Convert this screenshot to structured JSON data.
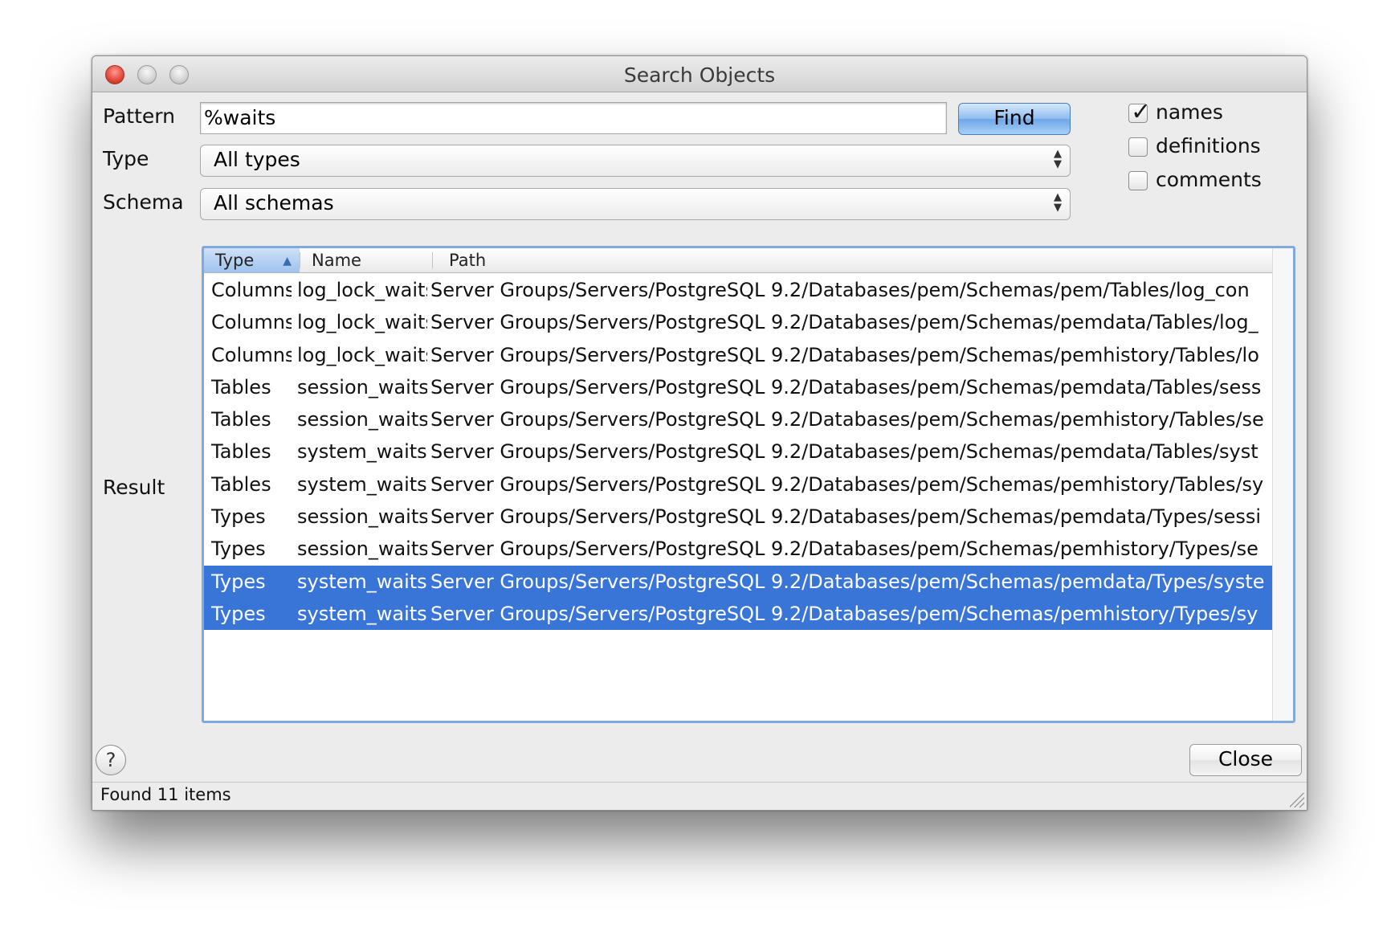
{
  "window": {
    "title": "Search Objects"
  },
  "labels": {
    "pattern": "Pattern",
    "type": "Type",
    "schema": "Schema",
    "result": "Result"
  },
  "pattern": {
    "value": "%waits"
  },
  "find_button": "Find",
  "type_select": {
    "value": "All types"
  },
  "schema_select": {
    "value": "All schemas"
  },
  "options": [
    {
      "label": "names",
      "checked": true
    },
    {
      "label": "definitions",
      "checked": false
    },
    {
      "label": "comments",
      "checked": false
    }
  ],
  "table": {
    "columns": [
      "Type",
      "Name",
      "Path"
    ],
    "sorted_column": "Type",
    "sort_direction": "ascending",
    "rows": [
      {
        "type": "Columns",
        "name": "log_lock_waits",
        "path": "Server Groups/Servers/PostgreSQL 9.2/Databases/pem/Schemas/pem/Tables/log_con",
        "selected": false
      },
      {
        "type": "Columns",
        "name": "log_lock_waits",
        "path": "Server Groups/Servers/PostgreSQL 9.2/Databases/pem/Schemas/pemdata/Tables/log_",
        "selected": false
      },
      {
        "type": "Columns",
        "name": "log_lock_waits",
        "path": "Server Groups/Servers/PostgreSQL 9.2/Databases/pem/Schemas/pemhistory/Tables/lo",
        "selected": false
      },
      {
        "type": "Tables",
        "name": "session_waits",
        "path": "Server Groups/Servers/PostgreSQL 9.2/Databases/pem/Schemas/pemdata/Tables/sess",
        "selected": false
      },
      {
        "type": "Tables",
        "name": "session_waits",
        "path": "Server Groups/Servers/PostgreSQL 9.2/Databases/pem/Schemas/pemhistory/Tables/se",
        "selected": false
      },
      {
        "type": "Tables",
        "name": "system_waits",
        "path": "Server Groups/Servers/PostgreSQL 9.2/Databases/pem/Schemas/pemdata/Tables/syst",
        "selected": false
      },
      {
        "type": "Tables",
        "name": "system_waits",
        "path": "Server Groups/Servers/PostgreSQL 9.2/Databases/pem/Schemas/pemhistory/Tables/sy",
        "selected": false
      },
      {
        "type": "Types",
        "name": "session_waits",
        "path": "Server Groups/Servers/PostgreSQL 9.2/Databases/pem/Schemas/pemdata/Types/sessi",
        "selected": false
      },
      {
        "type": "Types",
        "name": "session_waits",
        "path": "Server Groups/Servers/PostgreSQL 9.2/Databases/pem/Schemas/pemhistory/Types/se",
        "selected": false
      },
      {
        "type": "Types",
        "name": "system_waits",
        "path": "Server Groups/Servers/PostgreSQL 9.2/Databases/pem/Schemas/pemdata/Types/syste",
        "selected": true
      },
      {
        "type": "Types",
        "name": "system_waits",
        "path": "Server Groups/Servers/PostgreSQL 9.2/Databases/pem/Schemas/pemhistory/Types/sy",
        "selected": true
      }
    ]
  },
  "help_button": "?",
  "close_button": "Close",
  "status": "Found 11 items",
  "colors": {
    "selection": "#3875d7",
    "focus_ring": "#7fa9df",
    "close_light": "#e0453a"
  }
}
